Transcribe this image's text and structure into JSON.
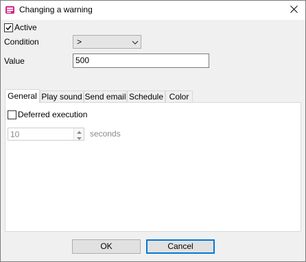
{
  "window": {
    "title": "Changing a warning"
  },
  "form": {
    "active_label": "Active",
    "active_checked": true,
    "condition_label": "Condition",
    "condition_value": ">",
    "value_label": "Value",
    "value_value": "500"
  },
  "tabs": [
    {
      "label": "General",
      "active": true
    },
    {
      "label": "Play sound",
      "active": false
    },
    {
      "label": "Send email",
      "active": false
    },
    {
      "label": "Schedule",
      "active": false
    },
    {
      "label": "Color",
      "active": false
    }
  ],
  "general": {
    "deferred_label": "Deferred execution",
    "deferred_checked": false,
    "delay_value": "10",
    "delay_unit": "seconds"
  },
  "buttons": {
    "ok": "OK",
    "cancel": "Cancel"
  },
  "icons": {
    "app": "warning-app-icon",
    "close": "close-icon",
    "check": "checkmark-icon",
    "dropdown": "chevron-down-icon",
    "spin_up": "spin-up-arrow-icon",
    "spin_down": "spin-down-arrow-icon"
  }
}
